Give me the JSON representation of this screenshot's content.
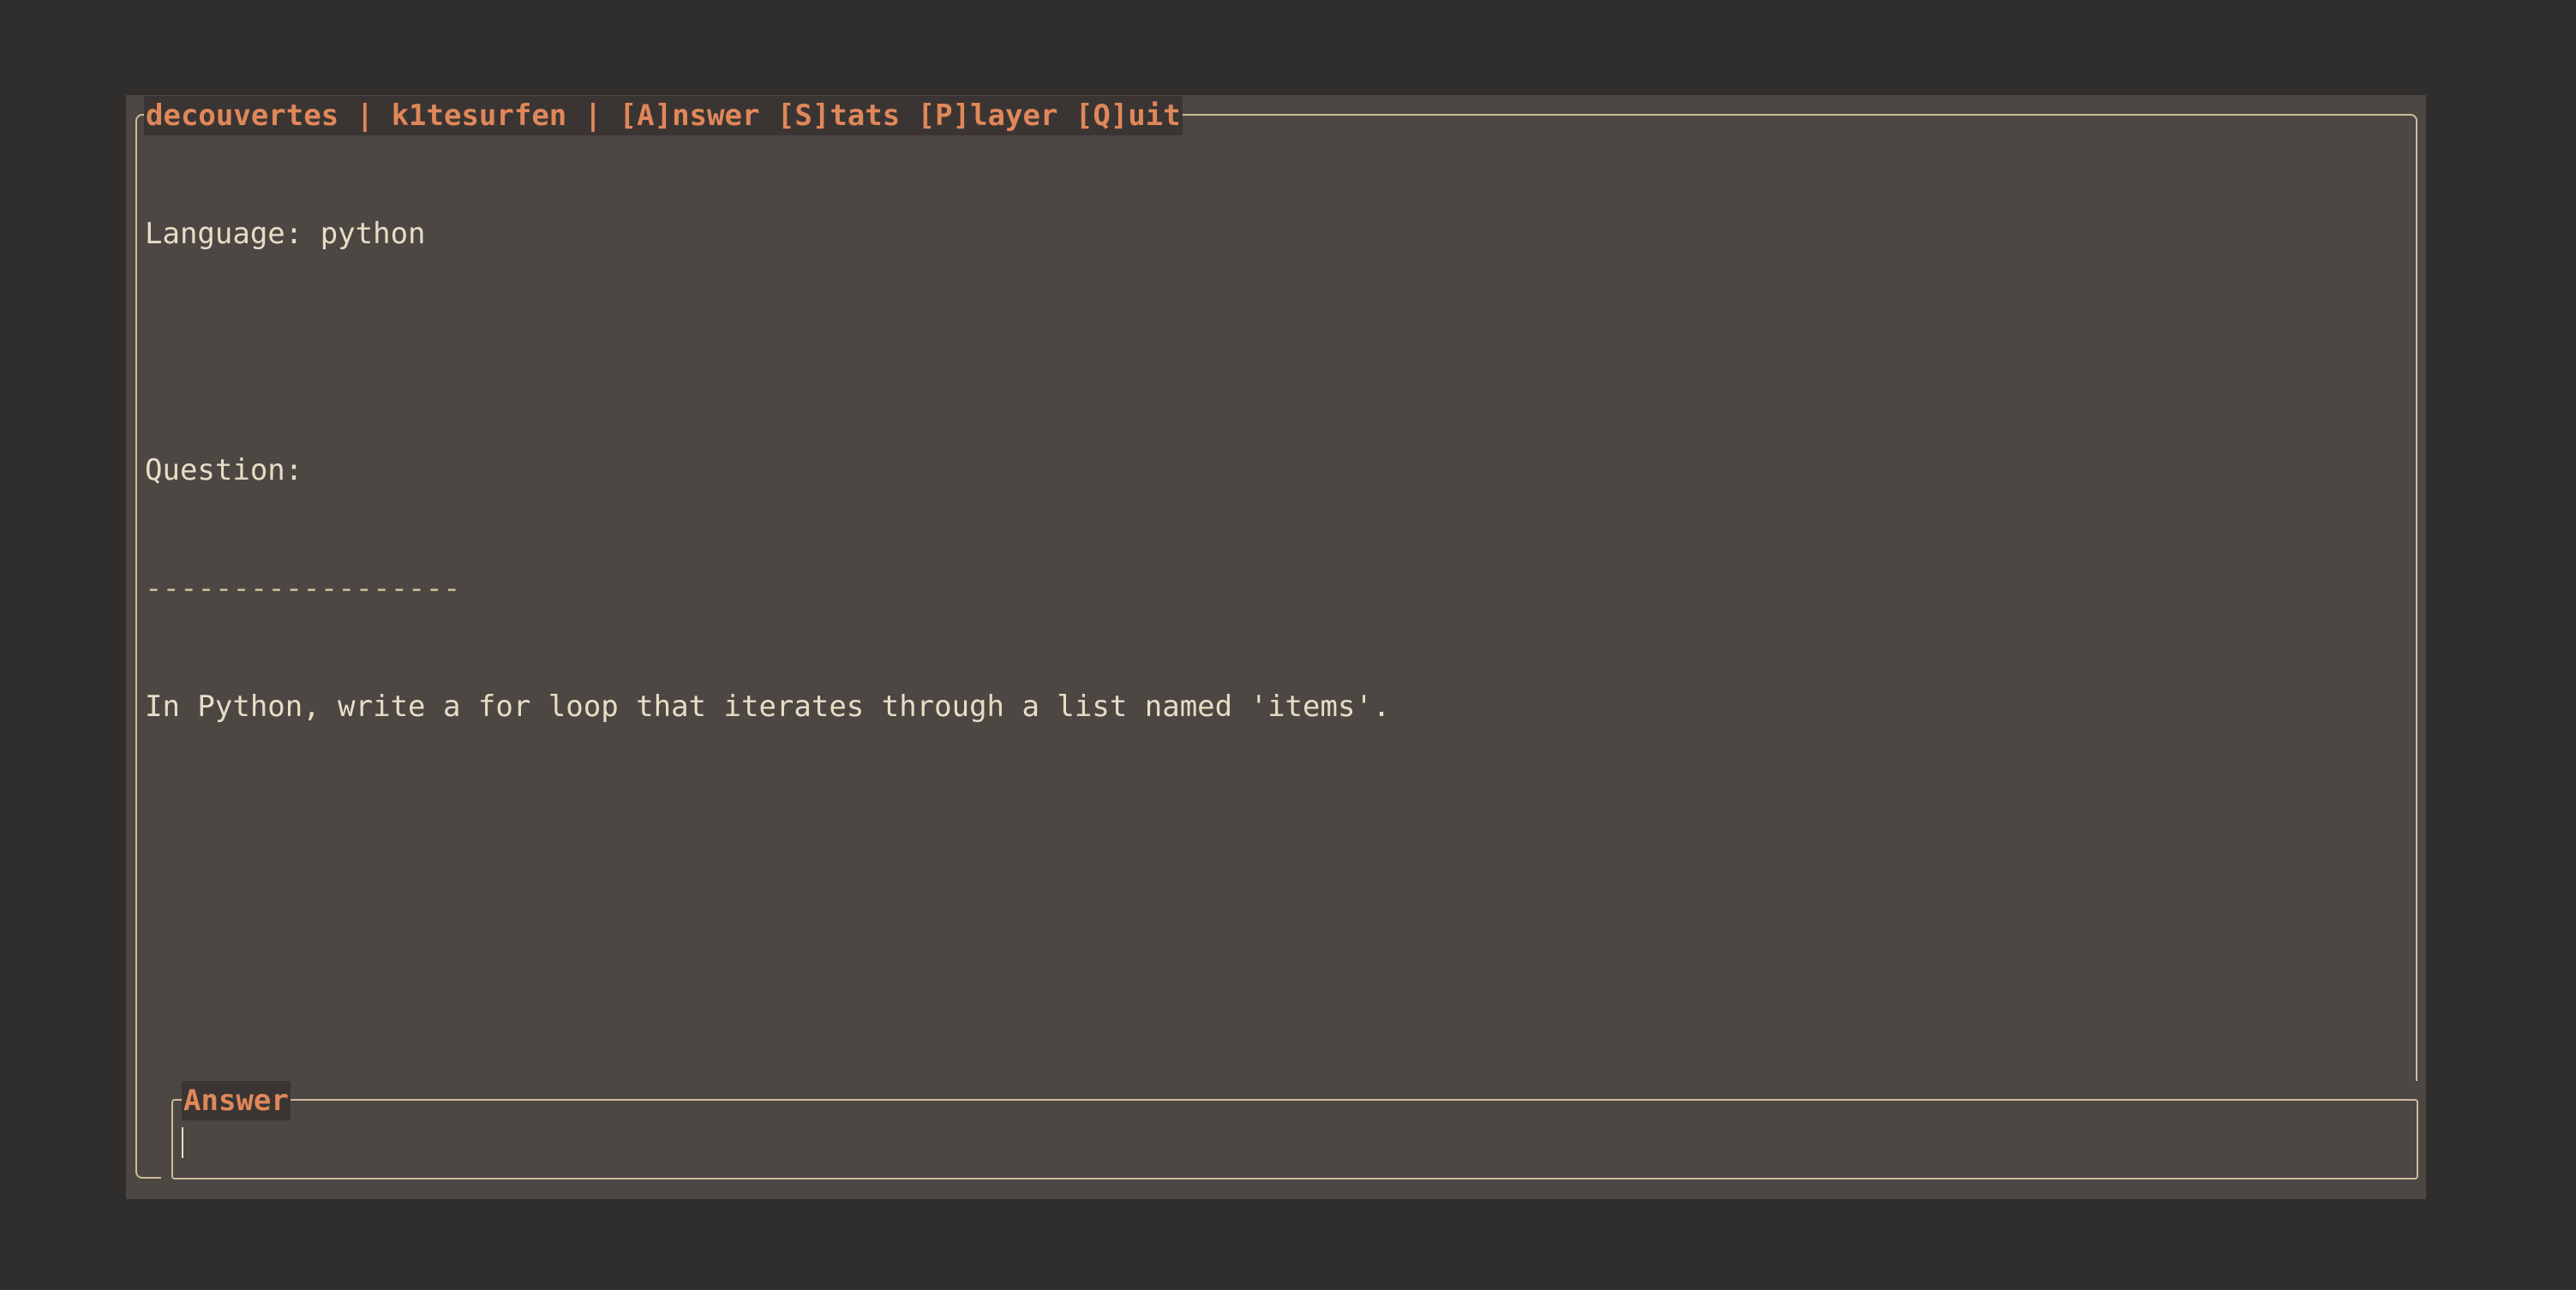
{
  "header": {
    "title": "decouvertes | k1tesurfen | [A]nswer [S]tats [P]layer [Q]uit"
  },
  "content": {
    "language_line": "Language: python",
    "question_label": "Question:",
    "divider": "------------------",
    "question_text": "In Python, write a for loop that iterates through a list named 'items'."
  },
  "answer": {
    "title": "Answer",
    "value": ""
  },
  "colors": {
    "background": "#2f2e2c",
    "panel": "#4c4743",
    "accent": "#e0875a",
    "text": "#e8dcc6",
    "border": "#cdbb9d"
  }
}
